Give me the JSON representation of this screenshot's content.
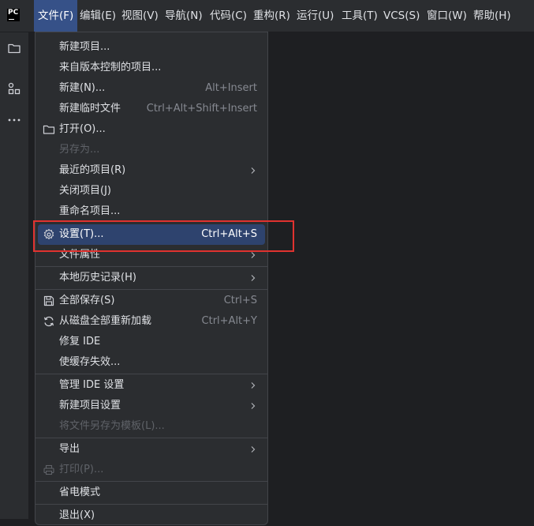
{
  "app": {
    "logo_text": "PC"
  },
  "menubar": {
    "items": [
      {
        "label": "文件(F)"
      },
      {
        "label": "编辑(E)"
      },
      {
        "label": "视图(V)"
      },
      {
        "label": "导航(N)"
      },
      {
        "label": "代码(C)"
      },
      {
        "label": "重构(R)"
      },
      {
        "label": "运行(U)"
      },
      {
        "label": "工具(T)"
      },
      {
        "label": "VCS(S)"
      },
      {
        "label": "窗口(W)"
      },
      {
        "label": "帮助(H)"
      }
    ]
  },
  "file_menu": {
    "items": [
      {
        "label": "新建项目..."
      },
      {
        "label": "来自版本控制的项目..."
      },
      {
        "label": "新建(N)...",
        "shortcut": "Alt+Insert"
      },
      {
        "label": "新建临时文件",
        "shortcut": "Ctrl+Alt+Shift+Insert"
      },
      {
        "label": "打开(O)...",
        "icon": "folder-icon"
      },
      {
        "label": "另存为...",
        "disabled": true
      },
      {
        "label": "最近的项目(R)",
        "submenu": true
      },
      {
        "label": "关闭项目(J)"
      },
      {
        "label": "重命名项目..."
      },
      {
        "label": "设置(T)...",
        "shortcut": "Ctrl+Alt+S",
        "icon": "gear-icon",
        "selected": true
      },
      {
        "label": "文件属性",
        "submenu": true
      },
      {
        "label": "本地历史记录(H)",
        "submenu": true
      },
      {
        "label": "全部保存(S)",
        "shortcut": "Ctrl+S",
        "icon": "save-icon"
      },
      {
        "label": "从磁盘全部重新加载",
        "shortcut": "Ctrl+Alt+Y",
        "icon": "reload-icon"
      },
      {
        "label": "修复 IDE"
      },
      {
        "label": "使缓存失效..."
      },
      {
        "label": "管理 IDE 设置",
        "submenu": true
      },
      {
        "label": "新建项目设置",
        "submenu": true
      },
      {
        "label": "将文件另存为模板(L)...",
        "disabled": true
      },
      {
        "label": "导出",
        "submenu": true
      },
      {
        "label": "打印(P)...",
        "disabled": true,
        "icon": "printer-icon"
      },
      {
        "label": "省电模式"
      },
      {
        "label": "退出(X)"
      }
    ]
  },
  "colors": {
    "background": "#1e1f22",
    "panel": "#2b2d30",
    "active_menu": "#365188",
    "selected_item": "#2e436e",
    "annotation_red": "#e0322f"
  }
}
